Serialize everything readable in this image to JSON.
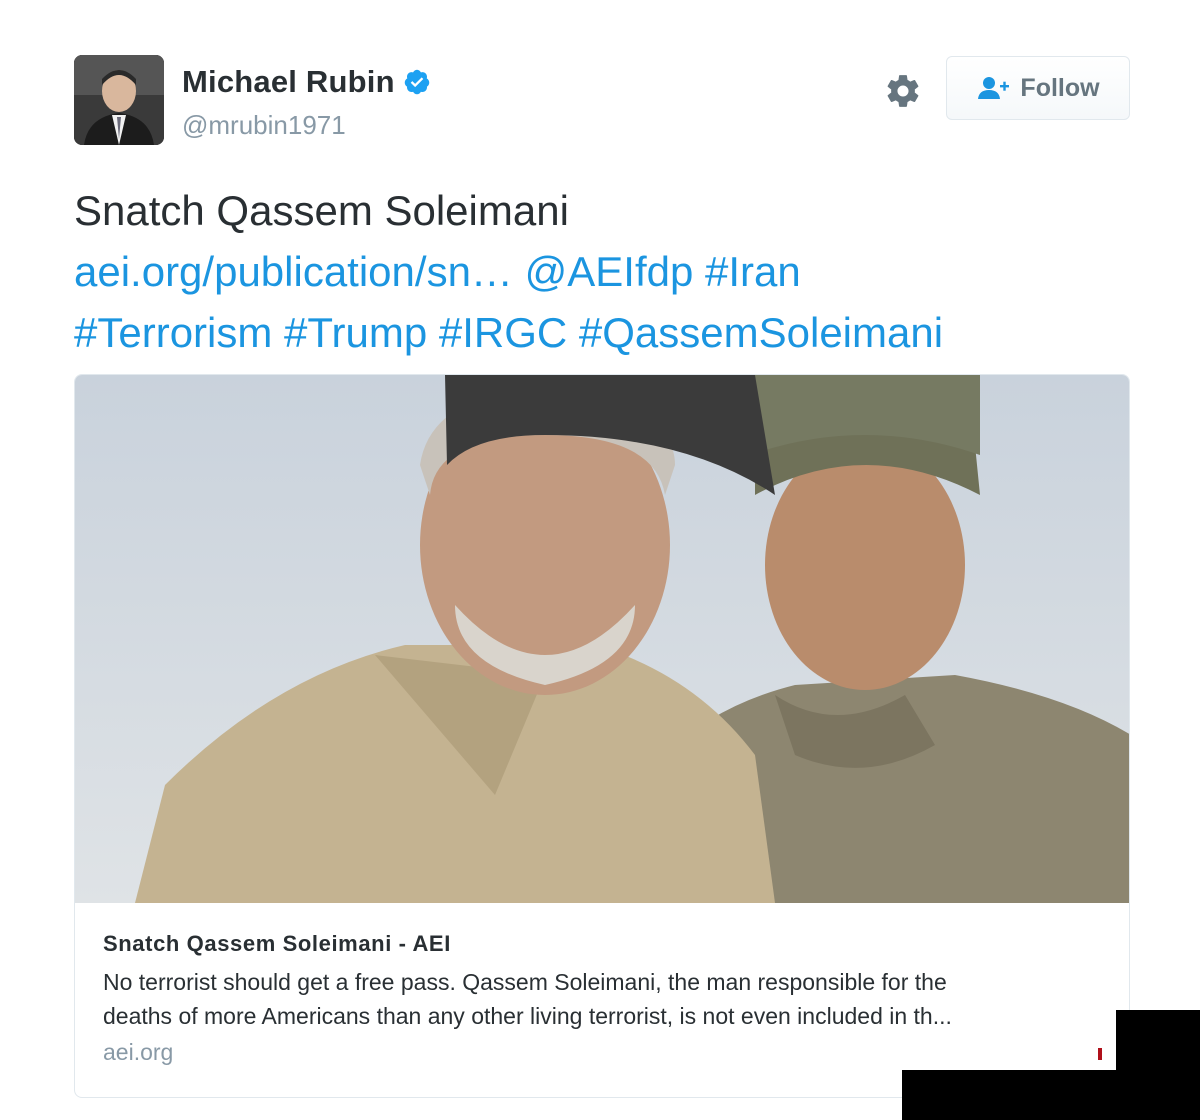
{
  "user": {
    "name": "Michael Rubin",
    "handle": "@mrubin1971",
    "verified": true
  },
  "actions": {
    "settings_icon": "gear-icon",
    "follow_label": "Follow"
  },
  "tweet": {
    "text": "Snatch Qassem Soleimani",
    "link": "aei.org/publication/sn…",
    "mention": "@AEIfdp",
    "hashtags": [
      "#Iran",
      "#Terrorism",
      "#Trump",
      "#IRGC",
      "#QassemSoleimani"
    ]
  },
  "card": {
    "title": "Snatch Qassem Soleimani - AEI",
    "description_line1": "No terrorist should get a free pass. Qassem Soleimani, the man responsible for the",
    "description_line2": "deaths of more Americans than any other living terrorist, is not even included in th...",
    "domain": "aei.org"
  },
  "colors": {
    "link": "#1b95e0",
    "text": "#292f33",
    "muted": "#8899a6",
    "verified": "#1da1f2",
    "border": "#e1e8ed"
  }
}
